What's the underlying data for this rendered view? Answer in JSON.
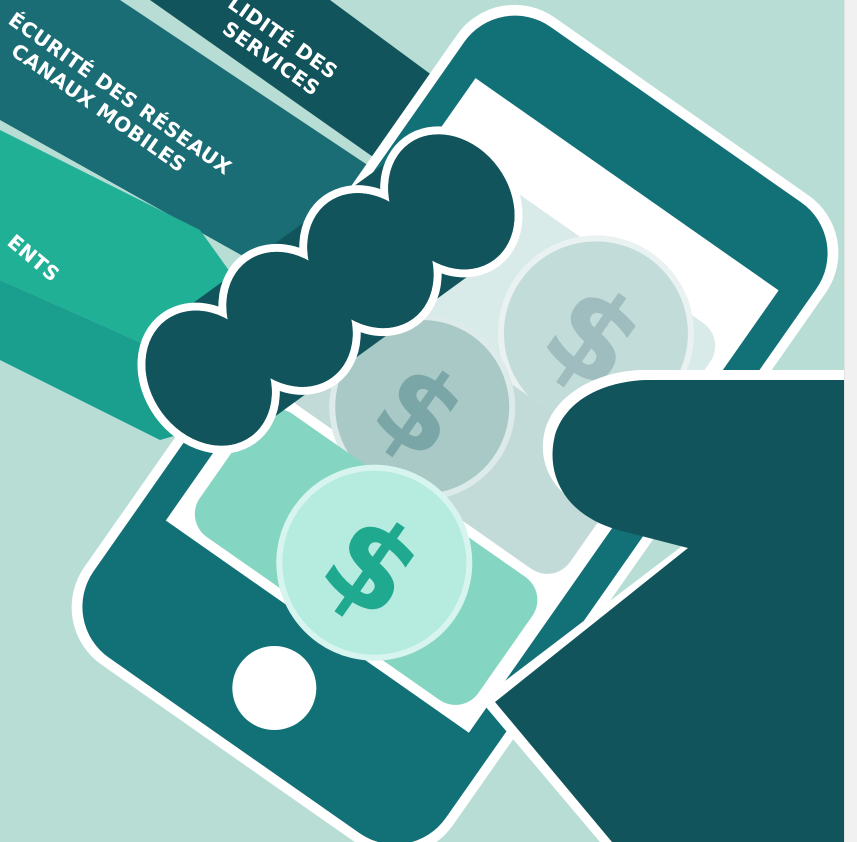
{
  "illustration": {
    "band_1": {
      "line_1": "LIDITÉ DES",
      "line_2": "SERVICES"
    },
    "band_2": {
      "line_1": "ÉCURITÉ DES RÉSEAUX",
      "line_2": "CANAUX MOBILES"
    },
    "band_3": {
      "line_1": "ENTS"
    },
    "currency_glyph": "$"
  },
  "colors": {
    "background": "#b7ddd4",
    "dark_teal": "#12545c",
    "mid_teal": "#1a6d74",
    "bright_teal": "#1fb096",
    "phone_body": "#127077",
    "screen_white": "#ffffff"
  }
}
